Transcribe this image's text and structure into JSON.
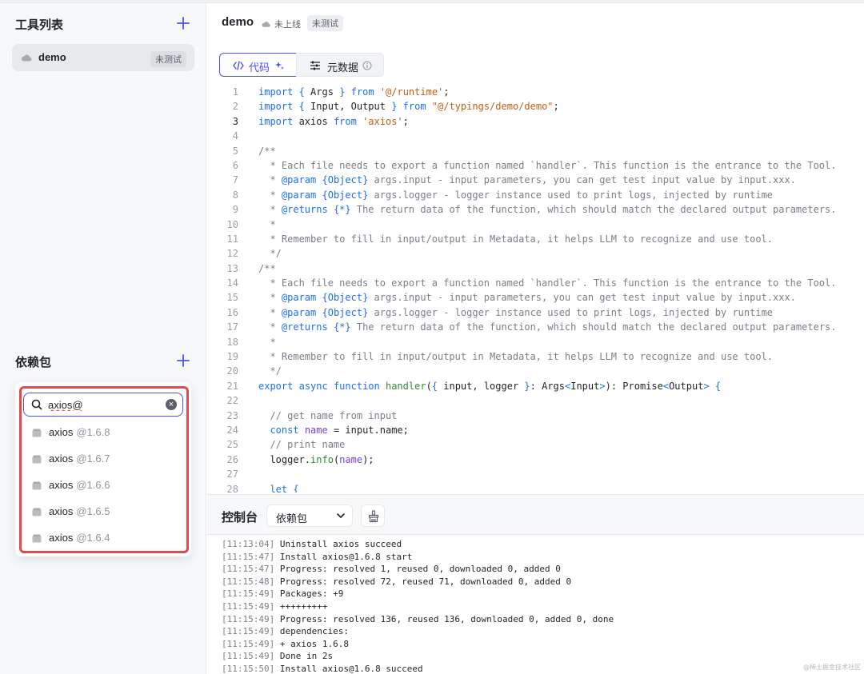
{
  "sidebar": {
    "tools_title": "工具列表",
    "tools": [
      {
        "name": "demo",
        "badge": "未测试"
      }
    ],
    "deps_title": "依赖包",
    "dependency_search": {
      "value": "axios@",
      "results": [
        {
          "name": "axios",
          "version": "@1.6.8"
        },
        {
          "name": "axios",
          "version": "@1.6.7"
        },
        {
          "name": "axios",
          "version": "@1.6.6"
        },
        {
          "name": "axios",
          "version": "@1.6.5"
        },
        {
          "name": "axios",
          "version": "@1.6.4"
        }
      ]
    }
  },
  "header": {
    "title": "demo",
    "status": "未上线",
    "badge": "未测试"
  },
  "tabs": [
    {
      "label": "代码",
      "active": true
    },
    {
      "label": "元数据",
      "active": false
    }
  ],
  "editor": {
    "active_line": 3,
    "lines": [
      "1",
      "2",
      "3",
      "4",
      "5",
      "6",
      "7",
      "8",
      "9",
      "10",
      "11",
      "12",
      "13",
      "14",
      "15",
      "16",
      "17",
      "18",
      "19",
      "20",
      "21",
      "22",
      "23",
      "24",
      "25",
      "26",
      "27",
      "28"
    ]
  },
  "console": {
    "title": "控制台",
    "select_value": "依赖包",
    "logs": [
      {
        "ts": "[11:13:04]",
        "msg": " Uninstall axios succeed"
      },
      {
        "ts": "[11:15:47]",
        "msg": " Install axios@1.6.8 start"
      },
      {
        "ts": "[11:15:47]",
        "msg": " Progress: resolved 1, reused 0, downloaded 0, added 0"
      },
      {
        "ts": "[11:15:48]",
        "msg": " Progress: resolved 72, reused 71, downloaded 0, added 0"
      },
      {
        "ts": "[11:15:49]",
        "msg": " Packages: +9"
      },
      {
        "ts": "[11:15:49]",
        "msg": " +++++++++"
      },
      {
        "ts": "[11:15:49]",
        "msg": " Progress: resolved 136, reused 136, downloaded 0, added 0, done"
      },
      {
        "ts": "[11:15:49]",
        "msg": " dependencies:"
      },
      {
        "ts": "[11:15:49]",
        "msg": " + axios 1.6.8"
      },
      {
        "ts": "[11:15:49]",
        "msg": " Done in 2s"
      },
      {
        "ts": "[11:15:50]",
        "msg": " Install axios@1.6.8 succeed"
      }
    ]
  },
  "watermark": "@稀土掘金技术社区",
  "colors": {
    "accent": "#4d53e8",
    "highlight_frame": "#e5484d"
  }
}
